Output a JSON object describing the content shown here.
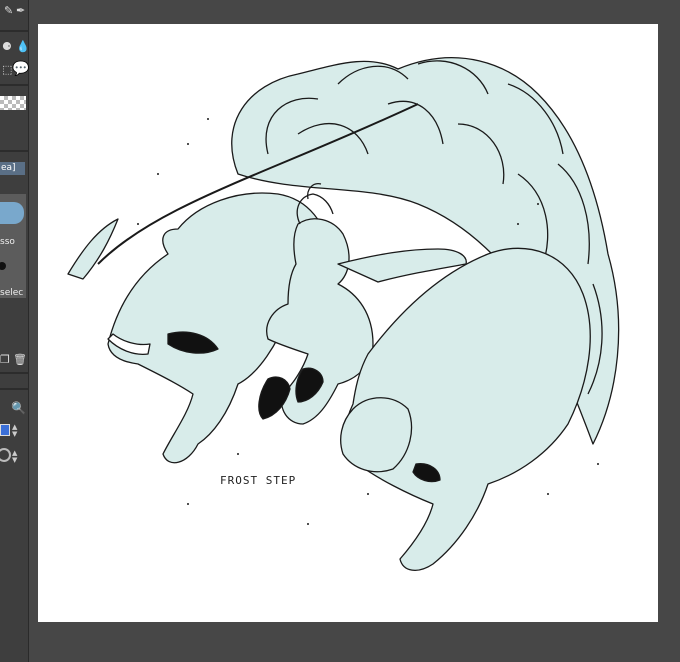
{
  "toolbar": {
    "tab_label": "ea]",
    "tool_name": "sso",
    "tool_option": "selec"
  },
  "canvas": {
    "caption": "FROST STEP"
  },
  "colors": {
    "workspace": "#474747",
    "canvas": "#ffffff",
    "fill": "#d8ecea",
    "ink": "#1a1a1a",
    "accent": "#3a6fd8"
  },
  "icons": [
    "brush-icon",
    "pen-icon",
    "droplet-icon",
    "lasso-icon",
    "speech-bubble-icon",
    "transparency-swatch-icon",
    "lasso-preview-icon",
    "dot-brush-icon",
    "copy-icon",
    "trash-icon",
    "zoom-icon",
    "color-swatch-icon",
    "spinner-icon",
    "circle-icon"
  ]
}
